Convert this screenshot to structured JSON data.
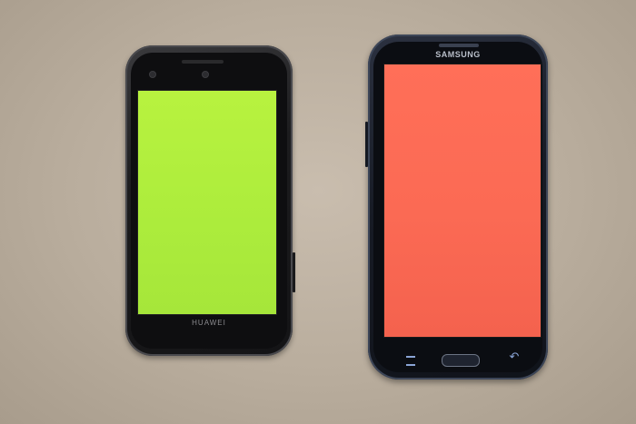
{
  "phones": {
    "left": {
      "brand": "HUAWEI",
      "screen_color": "#acec3c"
    },
    "right": {
      "brand": "SAMSUNG",
      "screen_color": "#fb6a54"
    }
  },
  "icons": {
    "menu": "menu-icon",
    "home": "home-button",
    "back": "back-arrow-icon"
  }
}
